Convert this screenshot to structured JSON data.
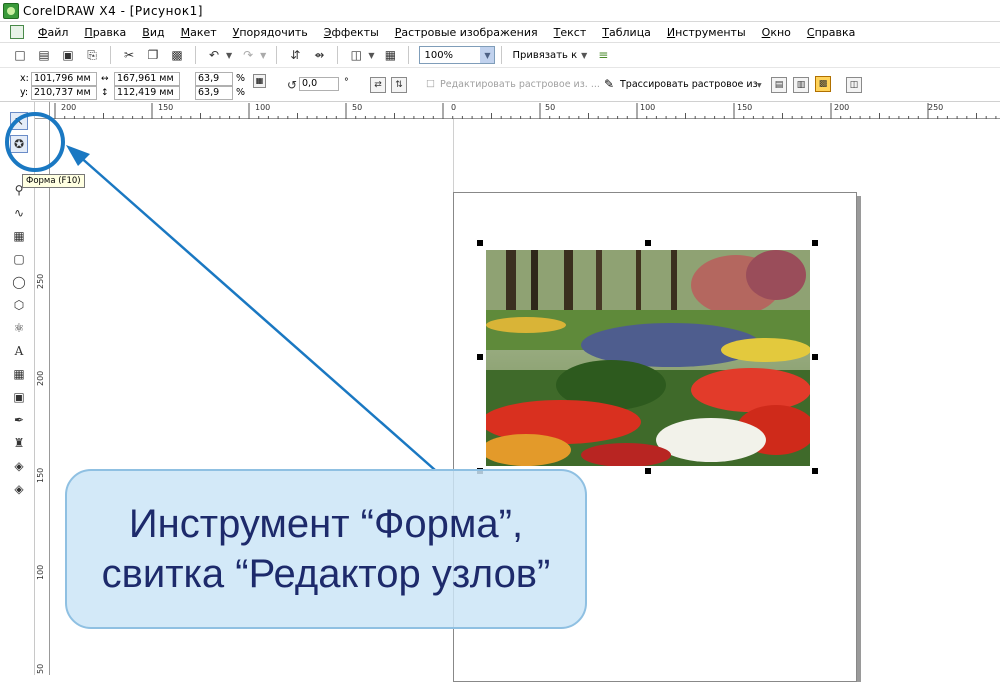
{
  "window": {
    "title": "CorelDRAW X4 - [Рисунок1]"
  },
  "menu": [
    "Файл",
    "Правка",
    "Вид",
    "Макет",
    "Упорядочить",
    "Эффекты",
    "Растровые изображения",
    "Текст",
    "Таблица",
    "Инструменты",
    "Окно",
    "Справка"
  ],
  "toolbar": {
    "icons": [
      "new-icon",
      "open-icon",
      "save-icon",
      "print-icon",
      "cut-icon",
      "copy-icon",
      "paste-icon",
      "undo-icon",
      "redo-icon",
      "import-icon",
      "export-icon",
      "app-launcher-icon",
      "welcome-icon"
    ],
    "zoom": "100%",
    "snap_label": "Привязать к"
  },
  "property_bar": {
    "x_label": "x:",
    "x_value": "101,796 мм",
    "y_label": "y:",
    "y_value": "210,737 мм",
    "width_value": "167,961 мм",
    "height_value": "112,419 мм",
    "scale_x": "63,9",
    "scale_y": "63,9",
    "percent": "%",
    "rotation": "0,0",
    "degree": "°",
    "edit_bitmap": "Редактировать растровое из. ...",
    "trace_bitmap": "Трассировать растровое из."
  },
  "rulers": {
    "top": [
      "200",
      "150",
      "100",
      "50",
      "0",
      "50",
      "100",
      "150",
      "200",
      "250"
    ],
    "left": [
      "250",
      "200",
      "150",
      "100",
      "50"
    ]
  },
  "tools": [
    "pick-tool",
    "shape-tool",
    "crop-tool",
    "zoom-tool",
    "freehand-tool",
    "smart-fill-tool",
    "rectangle-tool",
    "ellipse-tool",
    "polygon-tool",
    "basic-shapes-tool",
    "text-tool",
    "table-tool",
    "interactive-tool",
    "eyedropper-tool",
    "outline-tool",
    "fill-tool",
    "interactive-fill-tool"
  ],
  "tooltip": "Форма (F10)",
  "callout": {
    "line1": "Инструмент “Форма”,",
    "line2": "свитка “Редактор узлов”"
  },
  "colors": {
    "callout_bg": "#cbe5f7",
    "callout_text": "#1d2a6b",
    "highlight_circle": "#1a78c2"
  }
}
